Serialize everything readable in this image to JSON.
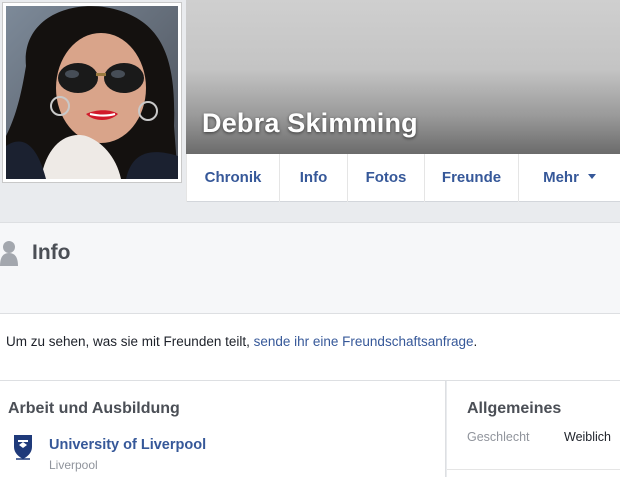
{
  "profile": {
    "name": "Debra Skimming"
  },
  "tabs": [
    {
      "label": "Chronik"
    },
    {
      "label": "Info"
    },
    {
      "label": "Fotos"
    },
    {
      "label": "Freunde"
    },
    {
      "label": "Mehr"
    }
  ],
  "info_section": {
    "title": "Info",
    "notice_text": "Um zu sehen, was sie mit Freunden teilt, ",
    "notice_link": "sende ihr eine Freundschaftsanfrage",
    "notice_end": "."
  },
  "work_education": {
    "title": "Arbeit und Ausbildung",
    "school_name": "University of Liverpool",
    "school_location": "Liverpool"
  },
  "general": {
    "title": "Allgemeines",
    "gender_label": "Geschlecht",
    "gender_value": "Weiblich"
  },
  "colors": {
    "link": "#365899",
    "background": "#e9ebee",
    "header_text": "#4b4f56"
  }
}
